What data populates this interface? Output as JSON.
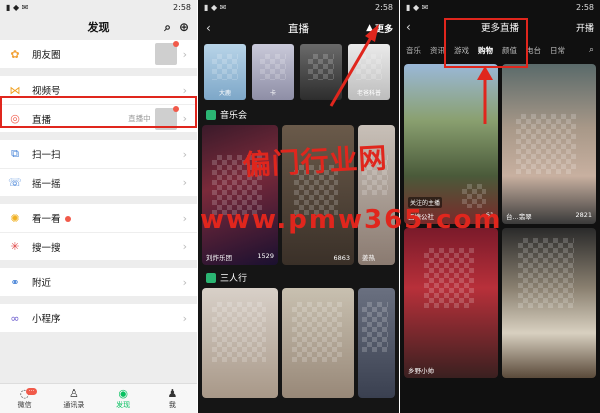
{
  "panel1": {
    "status_time": "2:58",
    "title": "发现",
    "items": [
      {
        "label": "朋友圈"
      },
      {
        "label": "视频号"
      },
      {
        "label": "直播",
        "right_text": "直播中"
      },
      {
        "label": "扫一扫"
      },
      {
        "label": "摇一摇"
      },
      {
        "label": "看一看"
      },
      {
        "label": "搜一搜"
      },
      {
        "label": "附近"
      },
      {
        "label": "小程序"
      }
    ],
    "tabs": [
      {
        "label": "微信"
      },
      {
        "label": "通讯录"
      },
      {
        "label": "发现"
      },
      {
        "label": "我"
      }
    ]
  },
  "panel2": {
    "status_time": "2:58",
    "title": "直播",
    "more_label": "更多",
    "top_thumbs": [
      {
        "label": "大鹿"
      },
      {
        "label": "卡"
      },
      {
        "label": ""
      },
      {
        "label": "老爸科普"
      }
    ],
    "section1_title": "音乐会",
    "cards": [
      {
        "name": "刘炸乐团",
        "count": "1529"
      },
      {
        "name": "",
        "count": "6863"
      },
      {
        "name": "姜热",
        "count": ""
      }
    ],
    "section2_title": "三人行"
  },
  "panel3": {
    "status_time": "2:58",
    "title": "更多直播",
    "broadcast_label": "开播",
    "categories": [
      "音乐",
      "资讯",
      "游戏",
      "购物",
      "颜值",
      "电台",
      "日常"
    ],
    "cards": [
      {
        "name": "西塘公社",
        "count": "61",
        "tag": "关注的主播"
      },
      {
        "name": "台...翡翠",
        "count": "2821"
      },
      {
        "name": "乡野小帅",
        "count": ""
      },
      {
        "name": "",
        "count": ""
      }
    ]
  },
  "watermark": {
    "line1": "偏门行业网",
    "line2": "www.pmw365.com"
  },
  "colors": {
    "highlight": "#e0261d",
    "accent_green": "#07c160",
    "badge_red": "#f15a4a"
  }
}
